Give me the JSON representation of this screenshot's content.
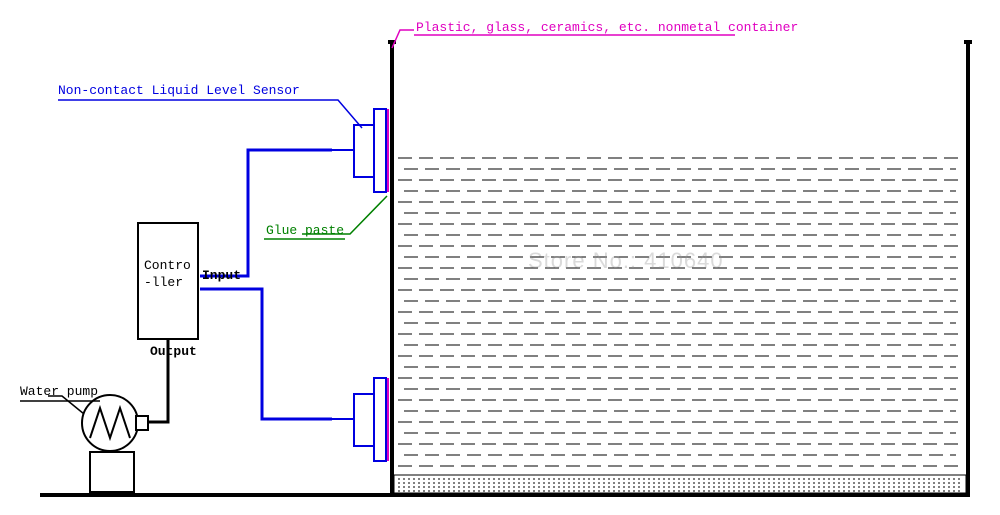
{
  "labels": {
    "container": "Plastic, glass, ceramics, etc. nonmetal container",
    "sensor": "Non-contact Liquid Level Sensor",
    "glue": "Glue paste",
    "controller_line1": "Contro",
    "controller_line2": "-ller",
    "input": "Input",
    "output": "Output",
    "pump": "Water pump",
    "watermark": "Store No.: 410640"
  },
  "colors": {
    "blue": "#0000e0",
    "magenta": "#e000c0",
    "green": "#008000",
    "black": "#000000"
  }
}
